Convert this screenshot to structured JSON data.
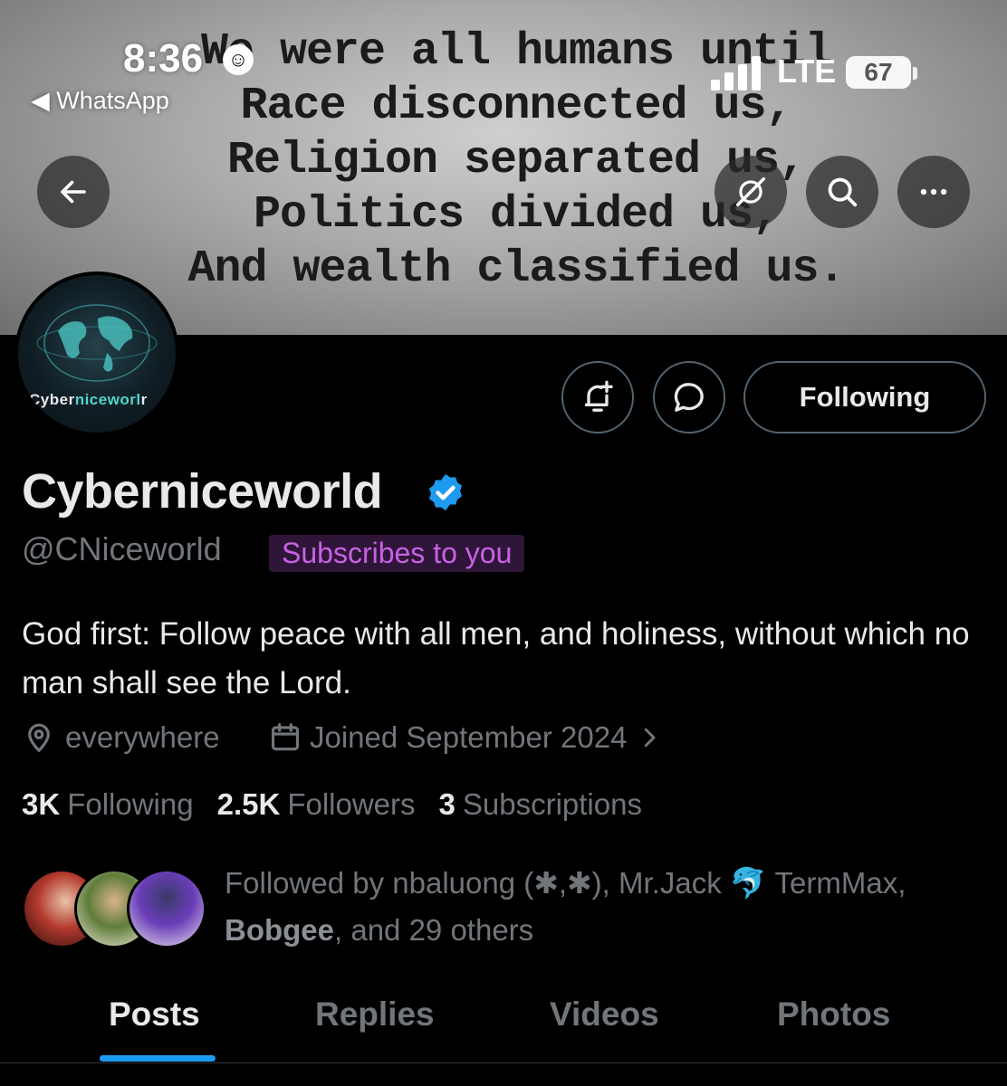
{
  "status_bar": {
    "time": "8:36",
    "back_app": "◀ WhatsApp",
    "network": "LTE",
    "battery": "67"
  },
  "banner": {
    "quote_lines": [
      "We were all humans until",
      "Race disconnected us,",
      "Religion separated us,",
      "Politics divided us,",
      "And wealth classified us."
    ]
  },
  "avatar": {
    "text_part1": "Cyber",
    "text_part2": "niceworl",
    "text_part3": "r"
  },
  "actions": {
    "following_label": "Following"
  },
  "profile": {
    "display_name": "Cyberniceworld",
    "handle": "@CNiceworld",
    "subscribes_badge": "Subscribes to you",
    "bio": "God first: Follow peace with all men, and holiness, without which no man shall see the Lord.",
    "location": "everywhere",
    "joined": "Joined September 2024"
  },
  "stats": {
    "following_count": "3K",
    "following_label": "Following",
    "followers_count": "2.5K",
    "followers_label": "Followers",
    "subscriptions_count": "3",
    "subscriptions_label": "Subscriptions"
  },
  "followed_by": {
    "prefix": "Followed by nbaluong (✱,✱), Mr.Jack ",
    "emoji": "🐬",
    "middle": " TermMax,",
    "bold_name": "Bobgee",
    "suffix": ", and 29 others"
  },
  "tabs": [
    "Posts",
    "Replies",
    "Videos",
    "Photos"
  ],
  "colors": {
    "accent": "#1d9bf0",
    "badge_text": "#c961e6",
    "badge_bg": "#2f1639",
    "muted": "#71767b"
  }
}
